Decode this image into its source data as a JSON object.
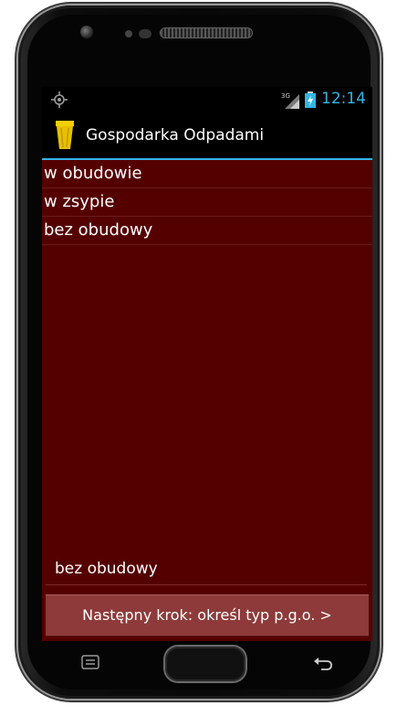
{
  "status_bar": {
    "time": "12:14",
    "network": "3G",
    "accent_color": "#33b5e5",
    "icons": [
      "gps-icon",
      "signal-icon",
      "battery-icon"
    ]
  },
  "action_bar": {
    "app_icon": "trash-bin-icon",
    "title": "Gospodarka Odpadami"
  },
  "list": {
    "items": [
      "w obudowie",
      "w zsypie",
      "bez obudowy"
    ]
  },
  "selected_value": "bez obudowy",
  "next_button": {
    "label": "Następny krok: określ typ p.g.o. >"
  },
  "colors": {
    "content_background": "#550000",
    "button_background": "#8e3a3a"
  },
  "hardware_keys": [
    "menu-key-icon",
    "home-button",
    "back-key-icon"
  ]
}
